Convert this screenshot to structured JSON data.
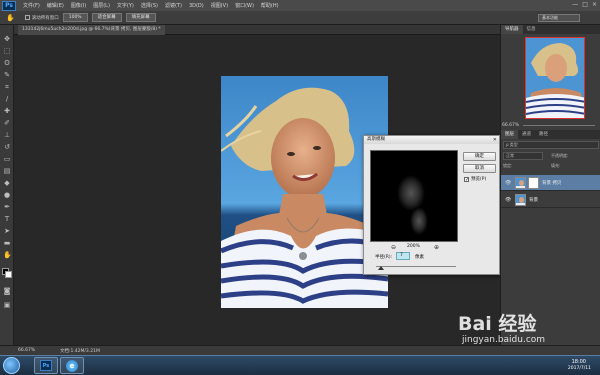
{
  "app": {
    "logo": "Ps",
    "menu": [
      "文件(F)",
      "编辑(E)",
      "图像(I)",
      "图层(L)",
      "文字(Y)",
      "选择(S)",
      "滤镜(T)",
      "3D(D)",
      "视图(V)",
      "窗口(W)",
      "帮助(H)"
    ],
    "window_controls": [
      "—",
      "□",
      "×"
    ]
  },
  "options_bar": {
    "checkbox_label": "滚动所有窗口",
    "buttons": [
      "100%",
      "适合屏幕",
      "填充屏幕"
    ],
    "workspace": "基本功能"
  },
  "document": {
    "tab_title": "133142j6mu5uch2n200d.jpg @ 66.7%(背景 拷贝, 图层蒙版/8) *"
  },
  "dialog": {
    "title": "高斯模糊",
    "ok_label": "确定",
    "cancel_label": "取消",
    "preview_label": "预览(P)",
    "preview_checked": "✓",
    "zoom_level": "200%",
    "radius_label": "半径(R):",
    "radius_value": "7",
    "radius_unit": "像素"
  },
  "panels": {
    "navigator_tabs": [
      "导航器",
      "信息"
    ],
    "navigator_zoom": "66.67%",
    "layers_tabs": [
      "图层",
      "通道",
      "路径"
    ],
    "layers_filter": "ρ 类型",
    "blend_mode": "正常",
    "opacity_label": "不透明度:",
    "lock_label": "锁定:",
    "fill_label": "填充:",
    "layers": [
      {
        "name": "背景 拷贝",
        "selected": true
      },
      {
        "name": "背景",
        "selected": false
      }
    ]
  },
  "status": {
    "zoom": "66.67%",
    "doc_size": "文档:1.42M/3.21M"
  },
  "taskbar": {
    "time": "18:00",
    "date": "2017/7/11"
  },
  "watermark": {
    "brand": "Bai 经验",
    "url": "jingyan.baidu.com"
  }
}
